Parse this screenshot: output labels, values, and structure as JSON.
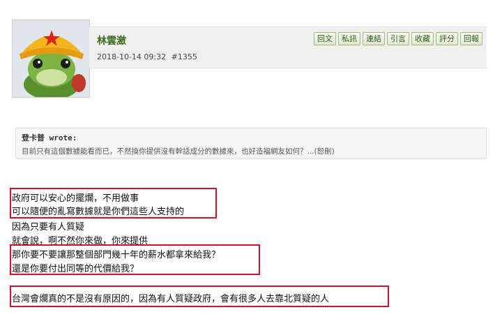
{
  "post": {
    "poster_name": "林雲瀲",
    "date": "2018-10-14 09:32",
    "post_number": "#1355",
    "avatar_icon": "frog-with-yellow-hat-icon"
  },
  "actions": [
    {
      "label": "回文"
    },
    {
      "label": "私訊"
    },
    {
      "label": "連結"
    },
    {
      "label": "引言"
    },
    {
      "label": "收藏"
    },
    {
      "label": "評分"
    },
    {
      "label": "回報"
    }
  ],
  "quote": {
    "author": "登卡普 wrote:",
    "text": "目前只有這個數據能看而已，不然換你提供沒有幹話成分的數據來，也好造福網友如何？...(恕刪)"
  },
  "body_lines": [
    "政府可以安心的擺爛，不用做事",
    "可以隨便的亂寫數據就是你們這些人支持的",
    "因為只要有人質疑",
    "就會說，啊不然你來做，你來提供",
    "那你要不要讓那整個部門幾十年的薪水都拿來給我？",
    "還是你要付出同等的代價給我？",
    "台灣會爛真的不是沒有原因的，因為有人質疑政府，會有很多人去靠北質疑的人"
  ],
  "colors": {
    "highlight_box": "#d0112b",
    "poster_name": "#3d6a1e",
    "button_border": "#9cb77f"
  }
}
